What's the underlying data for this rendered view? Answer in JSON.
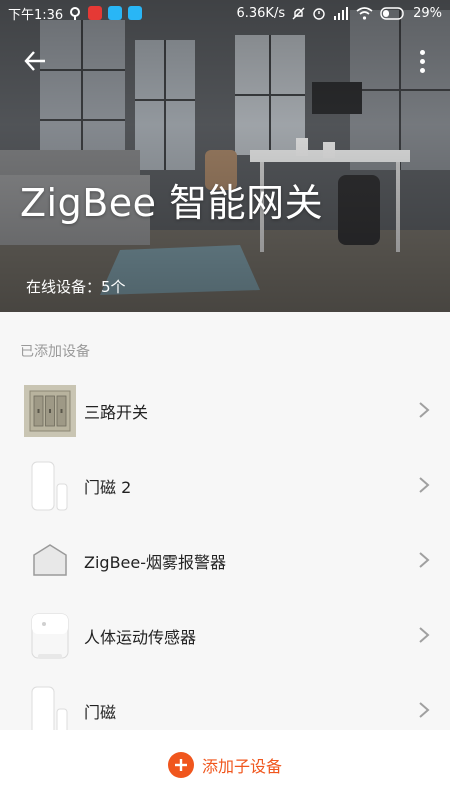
{
  "status_bar": {
    "time": "下午1:36",
    "speed": "6.36K/s",
    "battery": "29%",
    "colors": {
      "app1": "#e53935",
      "app2": "#29b6f6",
      "app3": "#29b6f6"
    }
  },
  "header": {
    "title": "ZigBee 智能网关",
    "online_label": "在线设备：",
    "online_count": "5个"
  },
  "section_label": "已添加设备",
  "devices": [
    {
      "name": "三路开关",
      "icon": "triple-switch-icon"
    },
    {
      "name": "门磁 2",
      "icon": "door-sensor-icon"
    },
    {
      "name": "ZigBee-烟雾报警器",
      "icon": "smoke-alarm-icon"
    },
    {
      "name": "人体运动传感器",
      "icon": "motion-sensor-icon"
    },
    {
      "name": "门磁",
      "icon": "door-sensor-icon"
    }
  ],
  "bottom": {
    "add_label": "添加子设备",
    "accent": "#f0561d"
  }
}
